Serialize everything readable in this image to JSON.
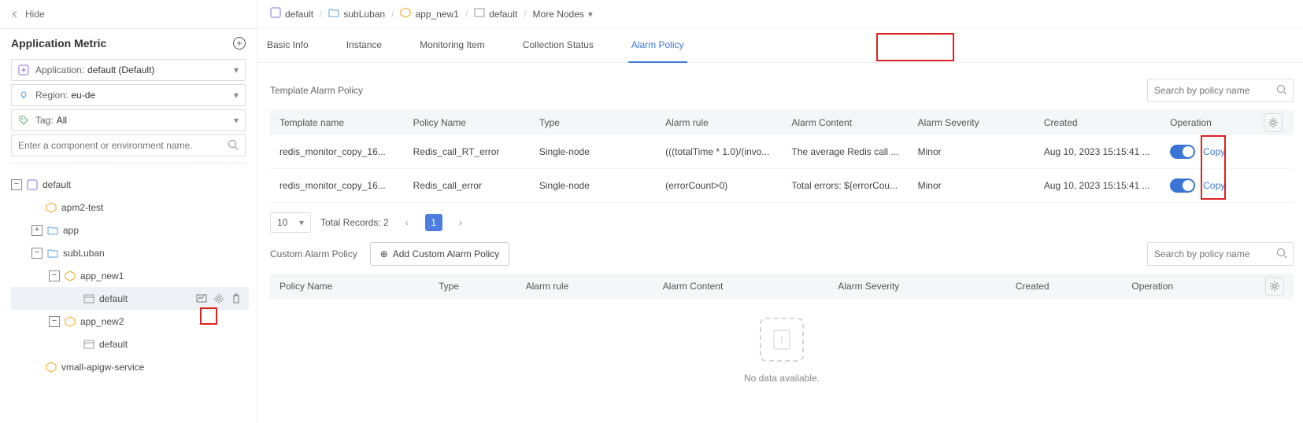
{
  "sidebar": {
    "hide_label": "Hide",
    "title": "Application Metric",
    "application": {
      "label": "Application:",
      "value": "default (Default)"
    },
    "region": {
      "label": "Region:",
      "value": "eu-de"
    },
    "tag": {
      "label": "Tag:",
      "value": "All"
    },
    "search_placeholder": "Enter a component or environment name.",
    "tree": {
      "root": "default",
      "items": [
        {
          "label": "apm2-test",
          "icon": "cube"
        },
        {
          "label": "app",
          "icon": "folder",
          "expander": "plus"
        },
        {
          "label": "subLuban",
          "icon": "folder",
          "expander": "minus",
          "children": [
            {
              "label": "app_new1",
              "icon": "cube",
              "expander": "minus",
              "children": [
                {
                  "label": "default",
                  "icon": "env",
                  "selected": true
                }
              ]
            },
            {
              "label": "app_new2",
              "icon": "cube",
              "expander": "minus",
              "children": [
                {
                  "label": "default",
                  "icon": "env"
                }
              ]
            }
          ]
        },
        {
          "label": "vmall-apigw-service",
          "icon": "cube"
        }
      ]
    }
  },
  "breadcrumb": {
    "segments": [
      "default",
      "subLuban",
      "app_new1",
      "default"
    ],
    "more": "More Nodes"
  },
  "tabs": [
    "Basic Info",
    "Instance",
    "Monitoring Item",
    "Collection Status",
    "Alarm Policy"
  ],
  "active_tab": "Alarm Policy",
  "template_panel": {
    "title": "Template Alarm Policy",
    "search_placeholder": "Search by policy name",
    "columns": [
      "Template name",
      "Policy Name",
      "Type",
      "Alarm rule",
      "Alarm Content",
      "Alarm Severity",
      "Created",
      "Operation"
    ],
    "rows": [
      {
        "template": "redis_monitor_copy_16...",
        "policy": "Redis_call_RT_error",
        "type": "Single-node",
        "rule": "(((totalTime * 1.0)/(invo...",
        "content": "The average Redis call ...",
        "severity": "Minor",
        "created": "Aug 10, 2023 15:15:41 ...",
        "op": "Copy"
      },
      {
        "template": "redis_monitor_copy_16...",
        "policy": "Redis_call_error",
        "type": "Single-node",
        "rule": "(errorCount>0)",
        "content": "Total errors: ${errorCou...",
        "severity": "Minor",
        "created": "Aug 10, 2023 15:15:41 ...",
        "op": "Copy"
      }
    ],
    "page_size": "10",
    "total_label": "Total Records: 2",
    "current_page": "1"
  },
  "custom_panel": {
    "title": "Custom Alarm Policy",
    "add_label": "Add Custom Alarm Policy",
    "search_placeholder": "Search by policy name",
    "columns": [
      "Policy Name",
      "Type",
      "Alarm rule",
      "Alarm Content",
      "Alarm Severity",
      "Created",
      "Operation"
    ],
    "nodata": "No data available."
  }
}
